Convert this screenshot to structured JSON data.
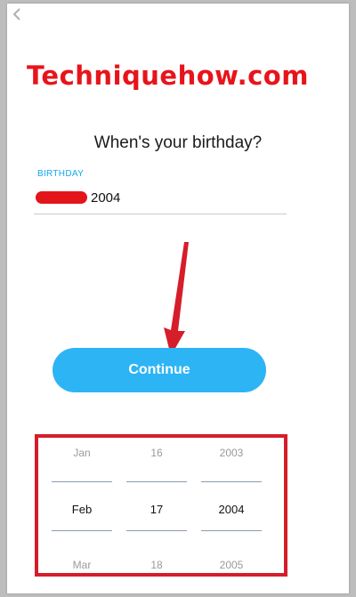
{
  "watermark": "Techniquehow.com",
  "page": {
    "title": "When's your birthday?"
  },
  "birthday_field": {
    "label": "BIRTHDAY",
    "value": "2004"
  },
  "continue_button": {
    "label": "Continue"
  },
  "date_picker": {
    "month": {
      "prev": "Jan",
      "selected": "Feb",
      "next": "Mar"
    },
    "day": {
      "prev": "16",
      "selected": "17",
      "next": "18"
    },
    "year": {
      "prev": "2003",
      "selected": "2004",
      "next": "2005"
    }
  },
  "colors": {
    "accent": "#2db4f5",
    "label_blue": "#16a8e8",
    "annotation_red": "#d51e2a"
  }
}
